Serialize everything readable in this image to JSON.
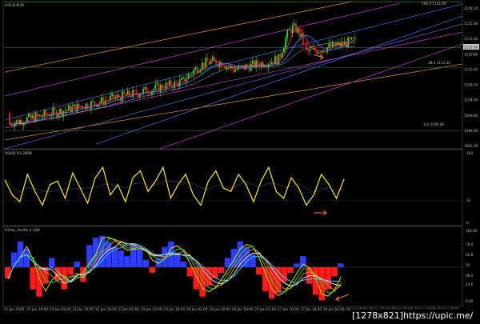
{
  "chart_data": [
    {
      "type": "line",
      "panel": "price",
      "title": "GOLD,M30",
      "ylim": [
        1090,
        1132
      ],
      "y_ticks": [
        "1129.20",
        "1125.00",
        "1121.00",
        "1116.80",
        "1112.40",
        "1108.20",
        "1104.00",
        "1099.80",
        "1096.00",
        "1092.00"
      ],
      "price_readout": "1119.00",
      "fib_labels": [
        "100.0 1132.40",
        "38.2 1113.30",
        "0.0 1094.80"
      ],
      "trend": {
        "start": 1096,
        "end": 1119,
        "peak": 1129
      }
    },
    {
      "type": "line",
      "panel": "rsi",
      "title": "RSI(8) 63.2898",
      "ylim": [
        0,
        100
      ],
      "y_ticks": [
        "100",
        "32",
        "0"
      ],
      "levels": [
        32
      ],
      "values": [
        62,
        40,
        30,
        70,
        45,
        25,
        55,
        60,
        35,
        72,
        50,
        28,
        65,
        80,
        40,
        55,
        30,
        65,
        75,
        45,
        60,
        80,
        35,
        55,
        70,
        40,
        25,
        60,
        75,
        50,
        45,
        70,
        55,
        30,
        60,
        80,
        45,
        35,
        65,
        50,
        25,
        40,
        70,
        55,
        35,
        63
      ]
    },
    {
      "type": "bar",
      "panel": "fisher",
      "title": "Fisher_Yur4ik 3.109",
      "ylim": [
        -2,
        2
      ],
      "y_ticks": [
        "100.00",
        "78.6",
        "61.8",
        "50",
        "38.2",
        "23.6",
        "0.00"
      ],
      "values": [
        -0.6,
        0.8,
        1.4,
        1.0,
        -1.2,
        -1.6,
        -0.9,
        0.5,
        -0.7,
        -1.2,
        -0.4,
        0.3,
        -0.8,
        1.2,
        1.6,
        1.7,
        1.4,
        1.1,
        0.9,
        0.6,
        1.3,
        1.0,
        0.4,
        -0.3,
        0.5,
        1.1,
        1.4,
        0.8,
        0.3,
        -0.5,
        -1.2,
        -1.6,
        -1.0,
        -0.6,
        -0.3,
        0.5,
        1.0,
        1.4,
        1.1,
        0.7,
        -0.4,
        -1.3,
        -1.7,
        -1.4,
        -0.8,
        -0.3,
        0.2,
        0.6,
        -0.9,
        -1.5,
        -1.8,
        -1.2,
        -0.5,
        0.2
      ]
    }
  ],
  "x_axis": [
    "21 Jan 2020",
    "21 Jan 18:00",
    "22 Jan 02:00",
    "22 Jan 10:00",
    "22 Jan 18:00",
    "23 Jan 02:00",
    "23 Jan 10:00",
    "23 Jan 18:00",
    "24 Jan 02:00",
    "24 Jan 10:00",
    "24 Jan 18:00",
    "27 Jan 02:00",
    "27 Jan 10:00",
    "27 Jan 18:00",
    "28 Jan 02:00",
    "28 Jan 10:00",
    "28 Jan 18:00",
    "29 Jan 02:00",
    "29 Jan 10:00",
    "29 Jan 18:00"
  ],
  "watermark": "[1278x821]https://upic.me/",
  "colors": {
    "background": "#000000",
    "bull_candle": "#19e619",
    "bear_candle": "#e61919",
    "fisher_positive": "#2d3dff",
    "fisher_negative": "#ff1a1a",
    "rsi": "#ffee00",
    "channel_orange": "#d98a1c",
    "channel_magenta": "#b531c6",
    "channel_blue": "#3a64d8",
    "arrow": "#ff7a33"
  }
}
